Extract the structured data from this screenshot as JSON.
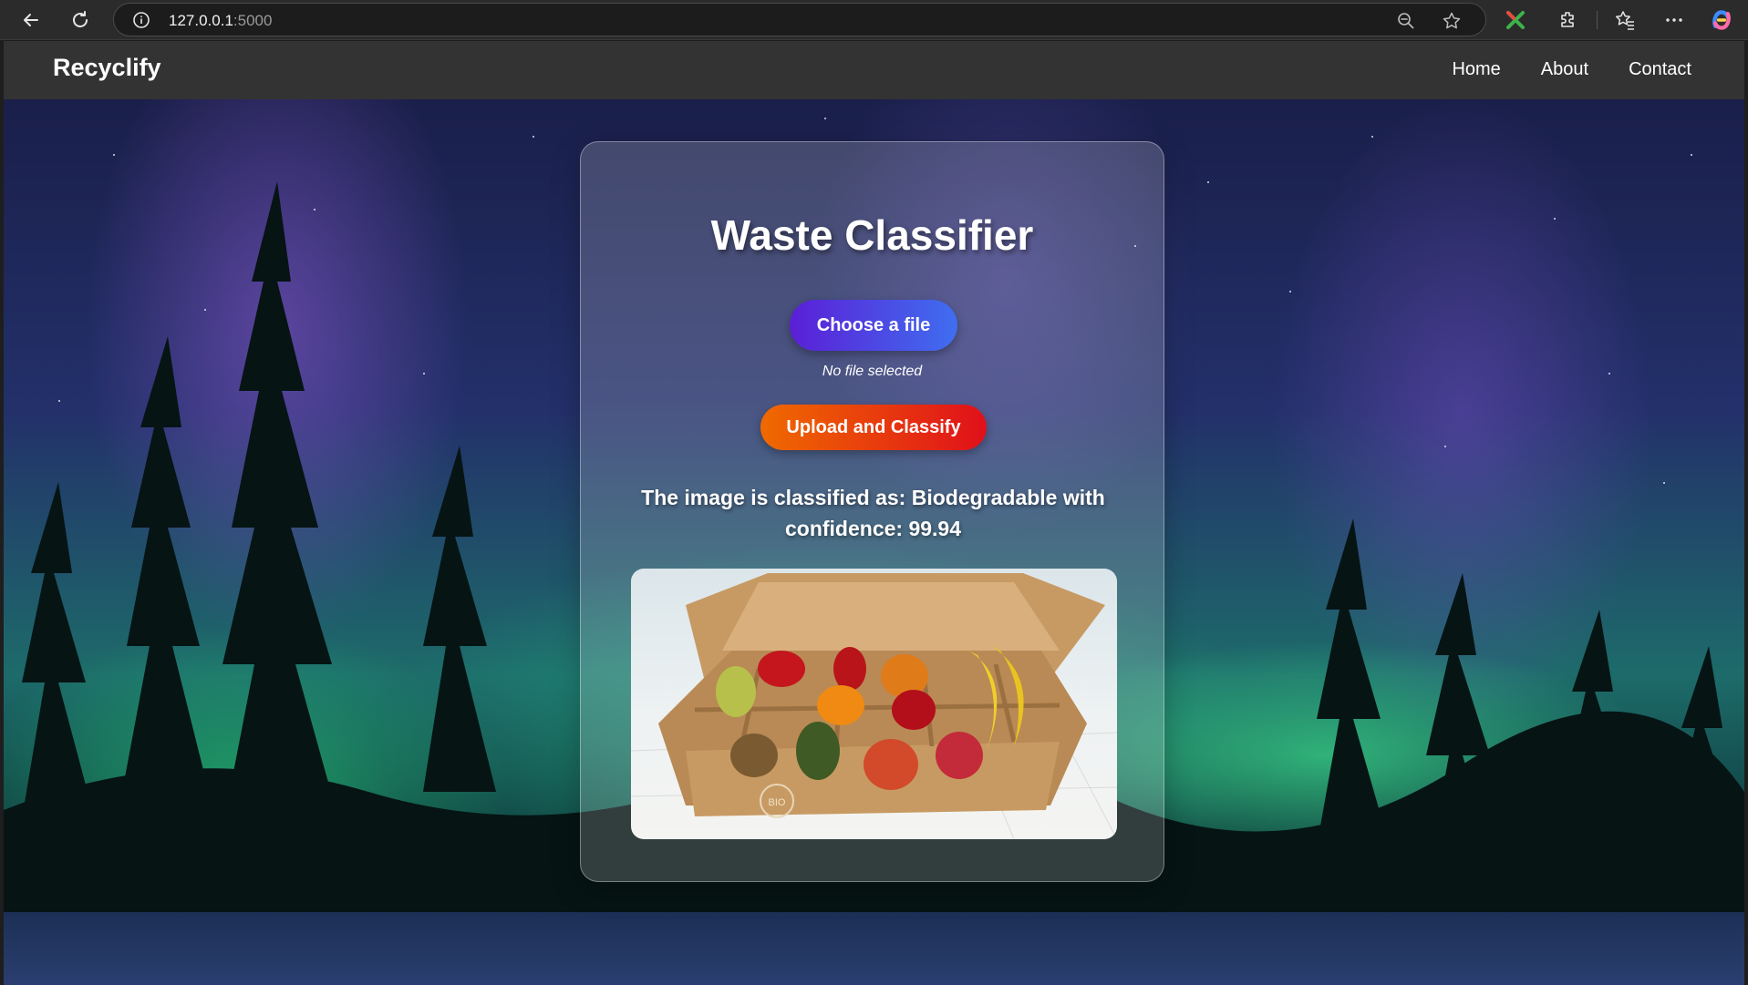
{
  "browser": {
    "url_host": "127.0.0.1",
    "url_port": ":5000"
  },
  "site": {
    "brand": "Recyclify",
    "nav": [
      {
        "label": "Home"
      },
      {
        "label": "About"
      },
      {
        "label": "Contact"
      }
    ]
  },
  "classifier": {
    "title": "Waste Classifier",
    "choose_label": "Choose a file",
    "file_status": "No file selected",
    "upload_label": "Upload and Classify",
    "result_text": "The image is classified as: Biodegradable with confidence: 99.94",
    "preview_box_text": "BIO"
  },
  "colors": {
    "navbar": "#333333",
    "choose_gradient": [
      "#5b1fd6",
      "#3f6ef0"
    ],
    "upload_gradient": [
      "#f06a00",
      "#e0101a"
    ]
  }
}
